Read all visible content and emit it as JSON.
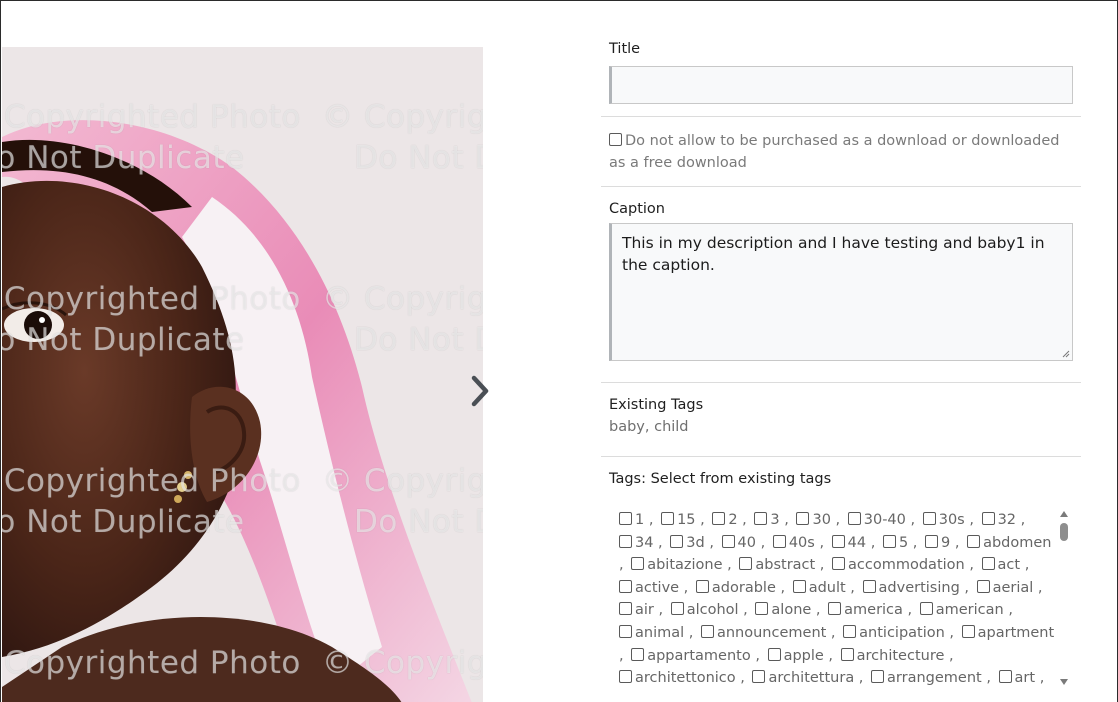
{
  "watermark": {
    "line1": "© Copyrighted Photo",
    "line2": "Do Not Duplicate"
  },
  "navigation": {
    "next_icon": "chevron-right-icon"
  },
  "form": {
    "title_label": "Title",
    "title_value": "",
    "download_checkbox_label": "Do not allow to be purchased as a download or downloaded as a free download",
    "caption_label": "Caption",
    "caption_value": "This in my description and I have testing and baby1 in the caption.",
    "existing_tags_label": "Existing Tags",
    "existing_tags_value": "baby, child",
    "tags_select_label": "Tags: Select from existing tags",
    "tags": [
      "1",
      "15",
      "2",
      "3",
      "30",
      "30-40",
      "30s",
      "32",
      "34",
      "3d",
      "40",
      "40s",
      "44",
      "5",
      "9",
      "abdomen",
      "abitazione",
      "abstract",
      "accommodation",
      "act",
      "active",
      "adorable",
      "adult",
      "advertising",
      "aerial",
      "air",
      "alcohol",
      "alone",
      "america",
      "american",
      "animal",
      "announcement",
      "anticipation",
      "apartment",
      "appartamento",
      "apple",
      "architecture",
      "architettonico",
      "architettura",
      "arrangement",
      "art"
    ]
  },
  "colors": {
    "towel_pink": "#e58fb8",
    "skin": "#4a2a1f",
    "background": "#ece6e7"
  }
}
